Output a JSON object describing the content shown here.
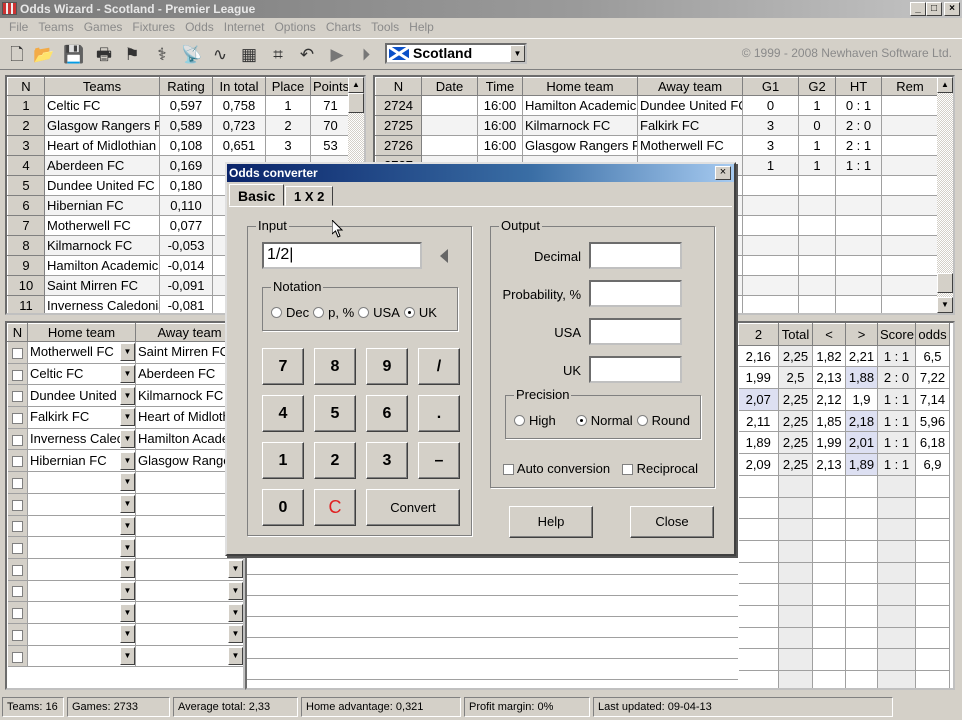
{
  "window": {
    "title": "Odds Wizard - Scotland - Premier League"
  },
  "menu": [
    "File",
    "Teams",
    "Games",
    "Fixtures",
    "Odds",
    "Internet",
    "Options",
    "Charts",
    "Tools",
    "Help"
  ],
  "toolbar": {
    "icons": [
      "new-file-icon",
      "open-folder-icon",
      "save-icon",
      "print-icon",
      "podium-icon",
      "satellite-icon",
      "satellite-dish-icon",
      "chart-curve-icon",
      "calculator-icon",
      "grid-icon",
      "undo-icon",
      "play-icon",
      "play-next-icon"
    ],
    "country": "Scotland",
    "copyright": "© 1999 - 2008 Newhaven Software Ltd."
  },
  "teams": {
    "headers": [
      "N",
      "Teams",
      "Rating",
      "In total",
      "Place",
      "Points"
    ],
    "rows": [
      [
        "1",
        "Celtic FC",
        "0,597",
        "0,758",
        "1",
        "71"
      ],
      [
        "2",
        "Glasgow Rangers F",
        "0,589",
        "0,723",
        "2",
        "70"
      ],
      [
        "3",
        "Heart of Midlothian F",
        "0,108",
        "0,651",
        "3",
        "53"
      ],
      [
        "4",
        "Aberdeen FC",
        "0,169",
        "",
        "",
        ""
      ],
      [
        "5",
        "Dundee United FC",
        "0,180",
        "",
        "",
        ""
      ],
      [
        "6",
        "Hibernian FC",
        "0,110",
        "",
        "",
        ""
      ],
      [
        "7",
        "Motherwell FC",
        "0,077",
        "",
        "",
        ""
      ],
      [
        "8",
        "Kilmarnock FC",
        "-0,053",
        "",
        "",
        ""
      ],
      [
        "9",
        "Hamilton Academic",
        "-0,014",
        "",
        "",
        ""
      ],
      [
        "10",
        "Saint Mirren FC",
        "-0,091",
        "",
        "",
        ""
      ],
      [
        "11",
        "Inverness Caledonia",
        "-0,081",
        "",
        "",
        ""
      ]
    ]
  },
  "results": {
    "headers": [
      "N",
      "Date",
      "Time",
      "Home team",
      "Away team",
      "G1",
      "G2",
      "HT",
      "Rem"
    ],
    "rows": [
      [
        "2724",
        "",
        "16:00",
        "Hamilton Academic",
        "Dundee United FC",
        "0",
        "1",
        "0 : 1",
        ""
      ],
      [
        "2725",
        "",
        "16:00",
        "Kilmarnock FC",
        "Falkirk FC",
        "3",
        "0",
        "2 : 0",
        ""
      ],
      [
        "2726",
        "",
        "16:00",
        "Glasgow Rangers F",
        "Motherwell FC",
        "3",
        "1",
        "2 : 1",
        ""
      ],
      [
        "2727",
        "",
        "",
        "",
        "",
        "1",
        "1",
        "1 : 1",
        ""
      ],
      [
        "",
        "",
        "",
        "",
        "",
        "",
        "",
        "",
        ""
      ],
      [
        "",
        "",
        "",
        "",
        "",
        "",
        "",
        "",
        ""
      ],
      [
        "",
        "",
        "",
        "",
        "",
        "",
        "",
        "",
        ""
      ],
      [
        "",
        "",
        "",
        "",
        "n F",
        "",
        "",
        "",
        ""
      ],
      [
        "",
        "",
        "",
        "",
        "mic",
        "",
        "",
        "",
        ""
      ],
      [
        "",
        "",
        "",
        "",
        "s F",
        "",
        "",
        "",
        ""
      ],
      [
        "",
        "",
        "",
        "",
        "",
        "",
        "",
        "",
        ""
      ]
    ]
  },
  "fixtures": {
    "headers": [
      "N",
      "Home team",
      "Away team"
    ],
    "rows": [
      [
        "Motherwell FC",
        "Saint Mirren FC"
      ],
      [
        "Celtic FC",
        "Aberdeen FC"
      ],
      [
        "Dundee United",
        "Kilmarnock FC"
      ],
      [
        "Falkirk FC",
        "Heart of Midlothian"
      ],
      [
        "Inverness Caledonian",
        "Hamilton Academic"
      ],
      [
        "Hibernian FC",
        "Glasgow Rangers"
      ],
      [
        "",
        ""
      ],
      [
        "",
        ""
      ],
      [
        "",
        ""
      ],
      [
        "",
        ""
      ],
      [
        "",
        ""
      ],
      [
        "",
        ""
      ],
      [
        "",
        ""
      ],
      [
        "",
        ""
      ],
      [
        "",
        ""
      ]
    ]
  },
  "odds": {
    "headers": [
      "2",
      "Total",
      "<",
      ">",
      "Score",
      "odds"
    ],
    "rows": [
      [
        "2,16",
        "2,25",
        "1,82",
        "2,21",
        "1 : 1",
        "6,5"
      ],
      [
        "1,99",
        "2,5",
        "2,13",
        "1,88",
        "2 : 0",
        "7,22"
      ],
      [
        "2,07",
        "2,25",
        "2,12",
        "1,9",
        "1 : 1",
        "7,14"
      ],
      [
        "2,11",
        "2,25",
        "1,85",
        "2,18",
        "1 : 1",
        "5,96"
      ],
      [
        "1,89",
        "2,25",
        "1,99",
        "2,01",
        "1 : 1",
        "6,18"
      ],
      [
        "2,09",
        "2,25",
        "2,13",
        "1,89",
        "1 : 1",
        "6,9"
      ]
    ]
  },
  "status": [
    "Teams: 16",
    "Games: 2733",
    "Average total: 2,33",
    "Home advantage: 0,321",
    "Profit margin: 0%",
    "Last updated: 09-04-13"
  ],
  "dialog": {
    "title": "Odds converter",
    "tabs": [
      "Basic",
      "1 X 2"
    ],
    "active_tab": "Basic",
    "input_label": "Input",
    "input_value": "1/2",
    "notation_label": "Notation",
    "notation_options": [
      "Dec",
      "p, %",
      "USA",
      "UK"
    ],
    "notation_selected": "UK",
    "keys": [
      "7",
      "8",
      "9",
      "/",
      "4",
      "5",
      "6",
      ".",
      "1",
      "2",
      "3",
      "–",
      "0",
      "C"
    ],
    "convert": "Convert",
    "output_label": "Output",
    "outputs": [
      "Decimal",
      "Probability, %",
      "USA",
      "UK"
    ],
    "precision_label": "Precision",
    "precision_options": [
      "High",
      "Normal",
      "Round"
    ],
    "precision_selected": "Normal",
    "auto_conversion": "Auto conversion",
    "reciprocal": "Reciprocal",
    "help": "Help",
    "close": "Close",
    "clear_key_color": "#e02020"
  }
}
